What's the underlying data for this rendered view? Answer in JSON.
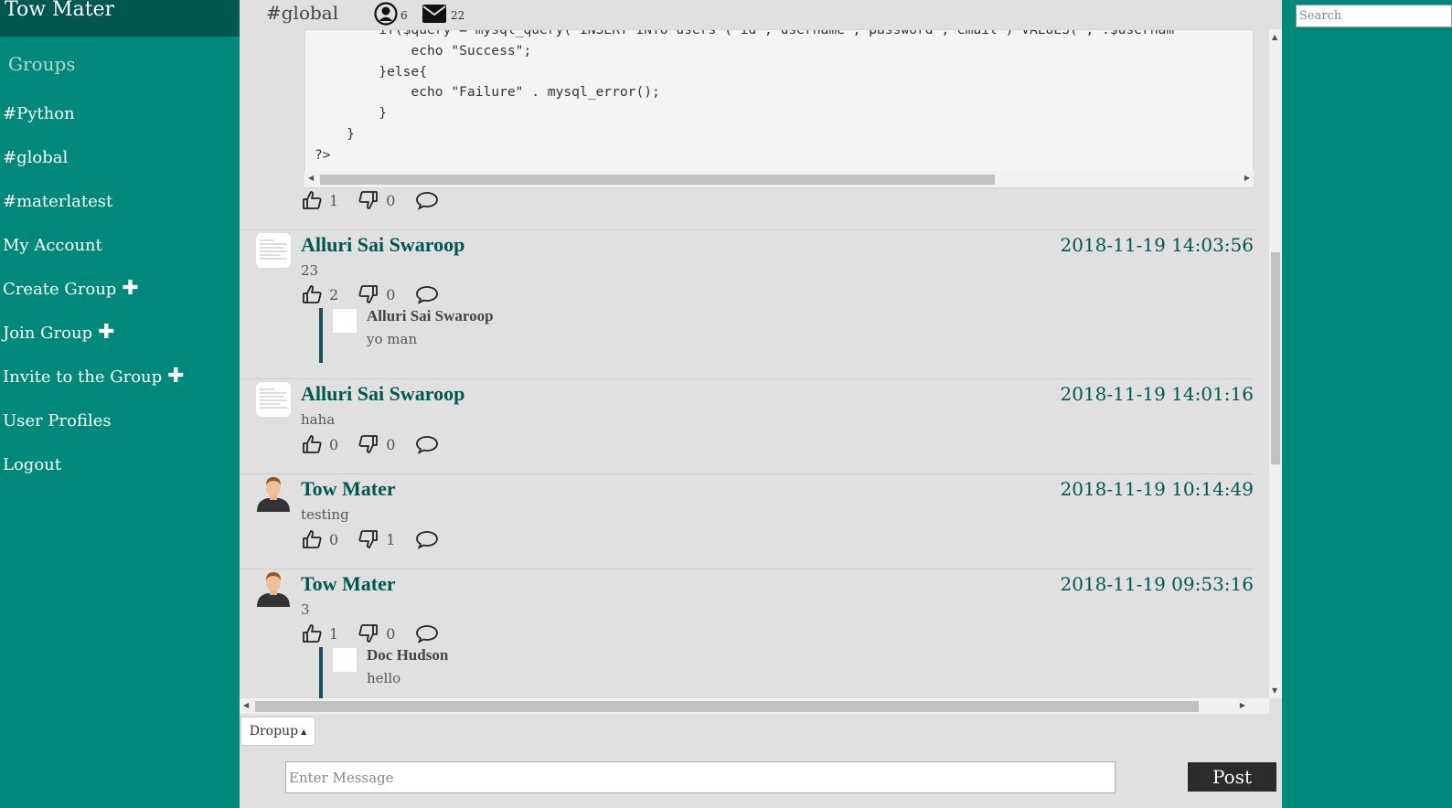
{
  "user": {
    "name": "Tow Mater"
  },
  "sidebar": {
    "groups_heading": "Groups",
    "items": [
      {
        "label": "#Python"
      },
      {
        "label": "#global"
      },
      {
        "label": "#materlatest"
      },
      {
        "label": "My Account"
      },
      {
        "label": "Create Group",
        "icon": "plus-icon",
        "plus": "✚"
      },
      {
        "label": "Join Group",
        "icon": "plus-icon",
        "plus": "✚"
      },
      {
        "label": "Invite to the Group",
        "icon": "plus-icon",
        "plus": "✚"
      },
      {
        "label": "User Profiles"
      },
      {
        "label": "Logout"
      }
    ]
  },
  "header": {
    "channel": "#global",
    "members_icon": "user-circle-icon",
    "members_count": "6",
    "messages_icon": "envelope-icon",
    "messages_count": "22"
  },
  "search": {
    "placeholder": "Search"
  },
  "code_snippet": {
    "lines": [
      "        if($query = mysql_query( INSERT INTO users ( id , username , password , email ) VALUES( , .$usernam",
      "            echo \"Success\";",
      "        }else{",
      "            echo \"Failure\" . mysql_error();",
      "        }",
      "    }",
      "?>"
    ],
    "likes": "1",
    "dislikes": "0"
  },
  "posts": [
    {
      "author": "Alluri Sai Swaroop",
      "time": "2018-11-19 14:03:56",
      "text": "23",
      "likes": "2",
      "dislikes": "0",
      "avatar": "document-avatar",
      "reply": {
        "author": "Alluri Sai Swaroop",
        "text": "yo man"
      }
    },
    {
      "author": "Alluri Sai Swaroop",
      "time": "2018-11-19 14:01:16",
      "text": "haha",
      "likes": "0",
      "dislikes": "0",
      "avatar": "document-avatar"
    },
    {
      "author": "Tow Mater",
      "time": "2018-11-19 10:14:49",
      "text": "testing",
      "likes": "0",
      "dislikes": "1",
      "avatar": "person-avatar"
    },
    {
      "author": "Tow Mater",
      "time": "2018-11-19 09:53:16",
      "text": "3",
      "likes": "1",
      "dislikes": "0",
      "avatar": "person-avatar",
      "reply": {
        "author": "Doc Hudson",
        "text": "hello"
      }
    }
  ],
  "composer": {
    "dropup_label": "Dropup",
    "message_placeholder": "Enter Message",
    "post_label": "Post"
  },
  "colors": {
    "sidebar_bg": "#00897b",
    "user_bar_bg": "#00574f",
    "author_color": "#00574f",
    "reply_border": "#1a4d63",
    "post_button_bg": "#2b2b2b"
  }
}
